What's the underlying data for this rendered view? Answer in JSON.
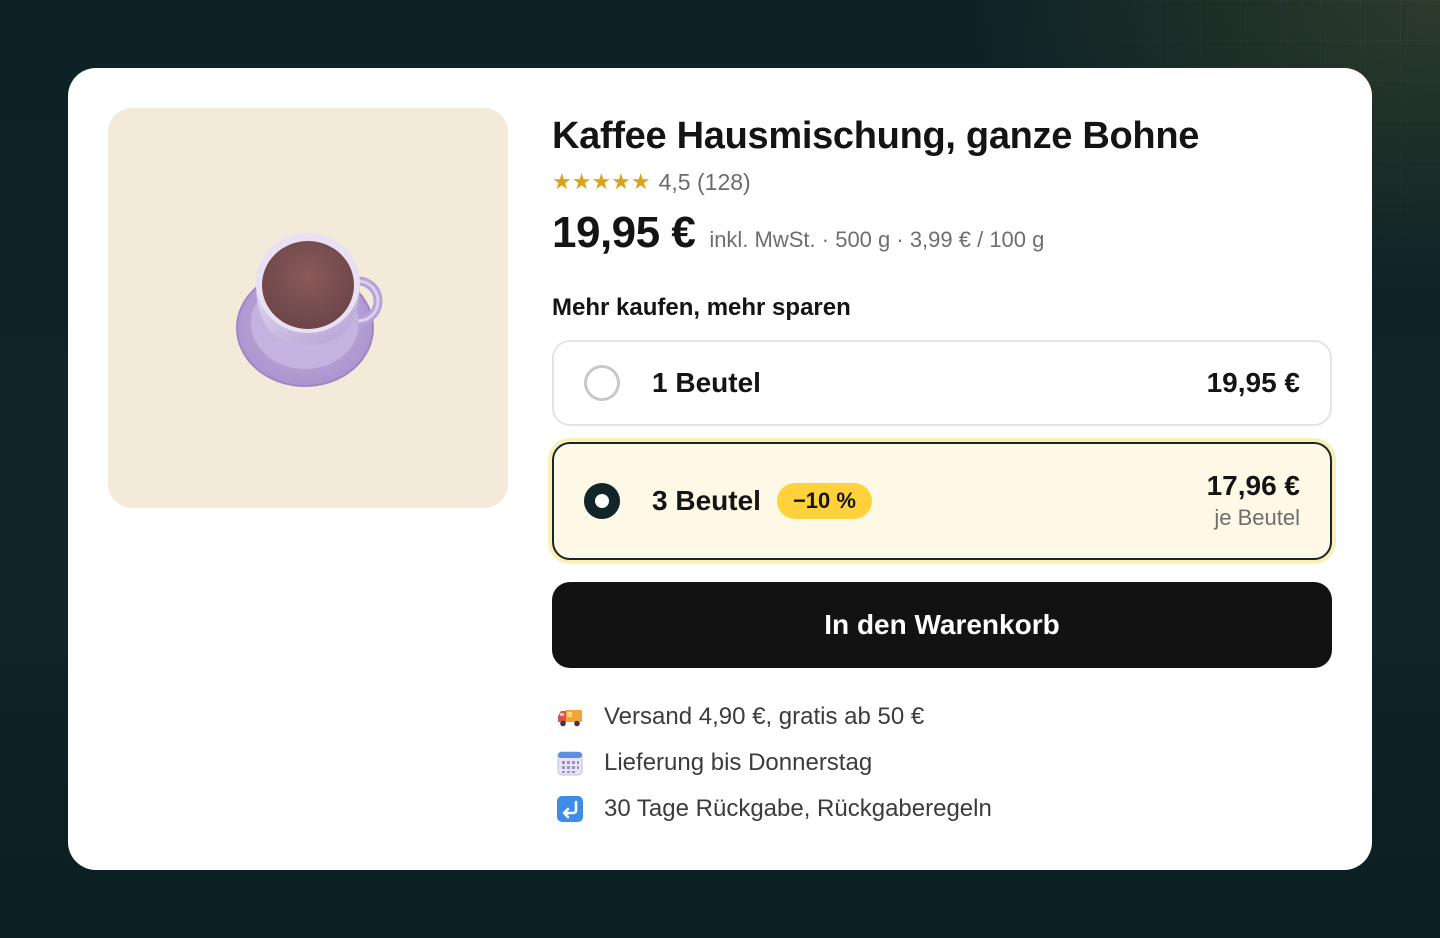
{
  "product": {
    "title": "Kaffee Hausmischung, ganze Bohne",
    "rating": {
      "stars": "★★★★★",
      "value": 4.5,
      "text": "4,5 (128)"
    },
    "price": "19,95 €",
    "price_meta": "inkl. MwSt. · 500 g · 3,99 € / 100 g",
    "image_icon": "coffee-cup"
  },
  "bundle": {
    "label": "Mehr kaufen, mehr sparen",
    "options": [
      {
        "label": "1 Beutel",
        "price": "19,95 €",
        "selected": false
      },
      {
        "label": "3 Beutel",
        "badge": "−10 %",
        "price": "17,96 €",
        "sub": "je Beutel",
        "selected": true
      }
    ]
  },
  "cta": {
    "label": "In den Warenkorb"
  },
  "features": [
    {
      "icon": "truck-icon",
      "text": "Versand 4,90 €, gratis ab 50 €"
    },
    {
      "icon": "calendar-icon",
      "text": "Lieferung bis Donnerstag"
    },
    {
      "icon": "return-arrow-icon",
      "text": "30 Tage Rückgabe, Rückgaberegeln"
    }
  ],
  "colors": {
    "accent_badge": "#ffd23c",
    "selected_bg": "#fdf9e6",
    "cta_bg": "#121212",
    "star": "#d9a41c",
    "image_bg": "#f4ead9"
  }
}
